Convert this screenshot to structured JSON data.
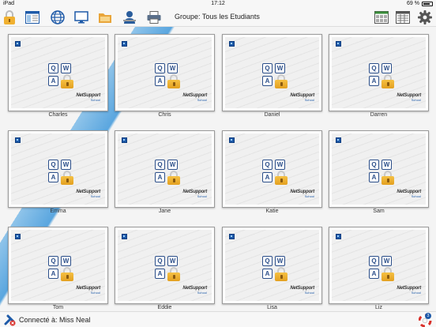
{
  "status_bar": {
    "device": "iPad",
    "time": "17:12",
    "battery": "69 %"
  },
  "toolbar": {
    "group_title": "Groupe: Tous les Etudiants",
    "left_icons": [
      "lock-icon",
      "view-layout-icon",
      "globe-icon",
      "monitor-icon",
      "folder-icon",
      "teacher-icon",
      "printer-icon"
    ],
    "right_icons": [
      "thumbnail-grid-icon",
      "list-view-icon",
      "gear-icon"
    ]
  },
  "students": [
    {
      "name": "Charles"
    },
    {
      "name": "Chris"
    },
    {
      "name": "Daniel"
    },
    {
      "name": "Darren"
    },
    {
      "name": "Emma"
    },
    {
      "name": "Jane"
    },
    {
      "name": "Katie"
    },
    {
      "name": "Sam"
    },
    {
      "name": "Tom"
    },
    {
      "name": "Eddie"
    },
    {
      "name": "Lisa"
    },
    {
      "name": "Liz"
    }
  ],
  "thumbnail": {
    "keys": [
      "Q",
      "W",
      "A"
    ],
    "brand": "NetSupport",
    "brand_sub": "School"
  },
  "bottom_bar": {
    "connection_text": "Connecté à: Miss Neal",
    "help_badge": "3"
  },
  "colors": {
    "accent": "#1e5aa8",
    "lock": "#f0b030",
    "stripe": "#5aa6df"
  }
}
